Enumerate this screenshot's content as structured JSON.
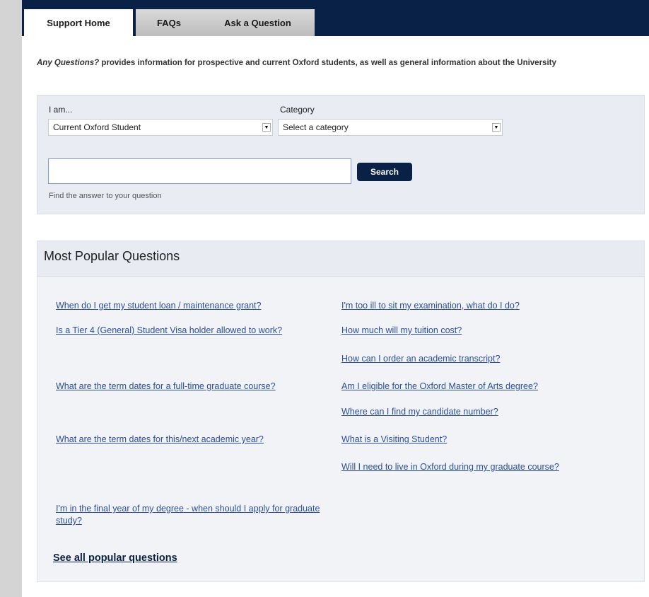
{
  "tabs": [
    {
      "label": "Support Home",
      "active": true
    },
    {
      "label": "FAQs",
      "active": false
    },
    {
      "label": "Ask a Question",
      "active": false
    }
  ],
  "intro": {
    "emphasis": "Any Questions?",
    "text": " provides information for prospective and current Oxford students, as well as general information about the University"
  },
  "search": {
    "i_am_label": "I am...",
    "i_am_value": "Current Oxford Student",
    "category_label": "Category",
    "category_value": "Select a category",
    "query_value": "",
    "button_label": "Search",
    "hint": "Find the answer to your question"
  },
  "popular": {
    "title": "Most Popular Questions",
    "left": [
      "When do I get my student loan / maintenance grant?",
      "Is a Tier 4 (General) Student Visa holder allowed to work?",
      "What are the term dates for a full-time graduate course?",
      "What are the term dates for this/next academic year?",
      "I'm in the final year of my degree - when should I apply for graduate study?"
    ],
    "right": [
      "I'm too ill to sit my examination, what do I do?",
      "How much will my tuition cost?",
      "How can I order an academic transcript?",
      "Am I eligible for the Oxford Master of Arts degree?",
      "Where can I find my candidate number?",
      "What is a Visiting Student?",
      "Will I need to live in Oxford during my graduate course?"
    ],
    "see_all": "See all popular questions"
  },
  "colors": {
    "navy": "#0a2147",
    "link": "#2a4fa0"
  }
}
